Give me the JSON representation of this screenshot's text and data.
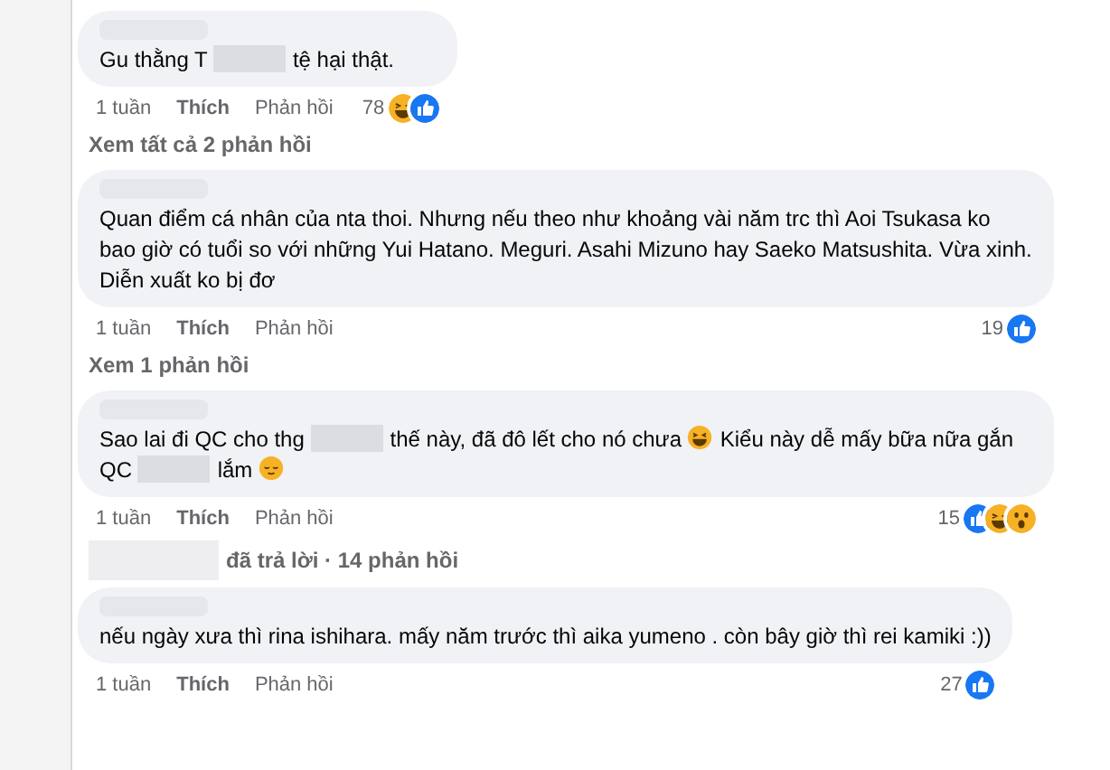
{
  "comments": [
    {
      "parts": [
        {
          "kind": "text",
          "text": "Gu thằng T"
        },
        {
          "kind": "blur"
        },
        {
          "kind": "text",
          "text": "tệ hại thật."
        }
      ],
      "time": "1 tuần",
      "like": "Thích",
      "reply": "Phản hồi",
      "count": "78",
      "reactions": [
        {
          "kind": "haha"
        },
        {
          "kind": "like"
        }
      ],
      "replies_link": "Xem tất cả 2 phản hồi"
    },
    {
      "parts": [
        {
          "kind": "text",
          "text": "Quan điểm cá nhân của nta thoi. Nhưng nếu theo như khoảng vài năm trc thì Aoi Tsukasa ko bao giờ có tuổi so với những Yui Hatano. Meguri. Asahi Mizuno hay Saeko Matsushita. Vừa xinh. Diễn xuất ko bị đơ"
        }
      ],
      "time": "1 tuần",
      "like": "Thích",
      "reply": "Phản hồi",
      "count": "19",
      "reactions": [
        {
          "kind": "like"
        }
      ],
      "replies_link": "Xem 1 phản hồi"
    },
    {
      "parts": [
        {
          "kind": "text",
          "text": "Sao lai đi QC cho thg"
        },
        {
          "kind": "blur"
        },
        {
          "kind": "text",
          "text": "thế này, đã đô lết cho nó chưa"
        },
        {
          "kind": "rofl"
        },
        {
          "kind": "text",
          "text": "Kiểu này dễ mấy bữa nữa gắn QC"
        },
        {
          "kind": "blur"
        },
        {
          "kind": "text",
          "text": "lắm"
        },
        {
          "kind": "relieved"
        }
      ],
      "time": "1 tuần",
      "like": "Thích",
      "reply": "Phản hồi",
      "count": "15",
      "reactions": [
        {
          "kind": "like"
        },
        {
          "kind": "haha"
        },
        {
          "kind": "wow"
        }
      ],
      "replies_summary": "đã trả lời · 14 phản hồi"
    },
    {
      "parts": [
        {
          "kind": "text",
          "text": "nếu ngày xưa thì rina ishihara. mấy năm trước thì aika yumeno . còn bây giờ thì rei kamiki :))"
        }
      ],
      "time": "1 tuần",
      "like": "Thích",
      "reply": "Phản hồi",
      "count": "27",
      "reactions": [
        {
          "kind": "like"
        }
      ]
    }
  ]
}
